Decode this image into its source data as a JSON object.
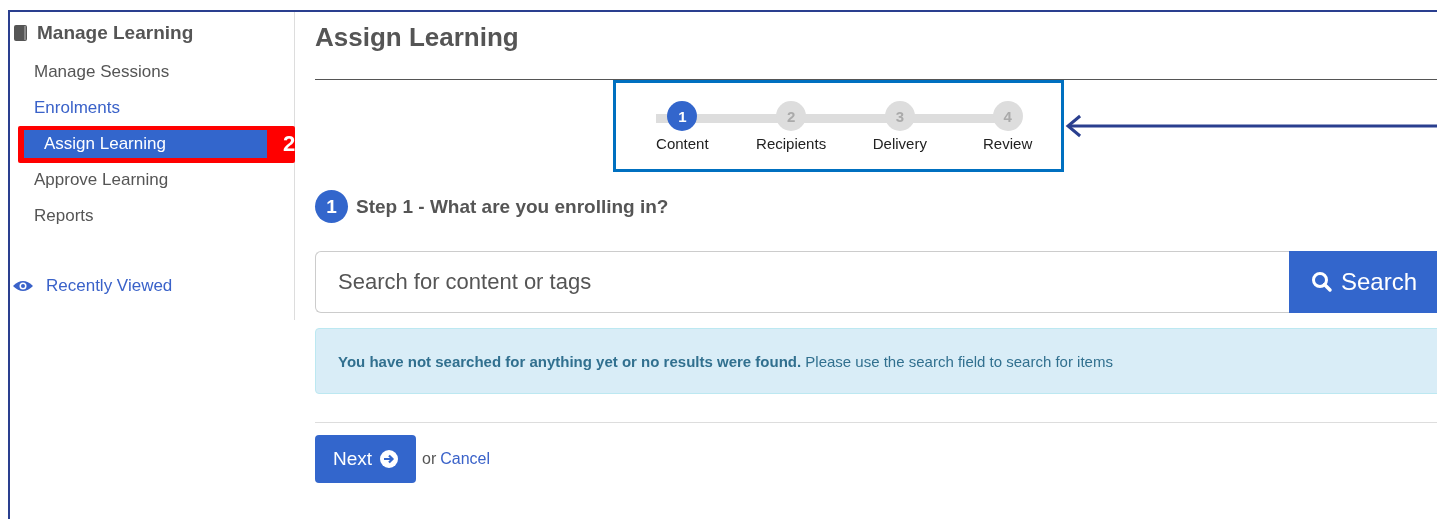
{
  "sidebar": {
    "title": "Manage Learning",
    "items": [
      {
        "label": "Manage Sessions",
        "kind": "text",
        "selected": false
      },
      {
        "label": "Enrolments",
        "kind": "link",
        "selected": false
      },
      {
        "label": "Assign Learning",
        "kind": "text",
        "selected": true
      },
      {
        "label": "Approve Learning",
        "kind": "text",
        "selected": false
      },
      {
        "label": "Reports",
        "kind": "text",
        "selected": false
      }
    ],
    "recent": "Recently Viewed"
  },
  "annotation": {
    "label": "2"
  },
  "page_title": "Assign Learning",
  "stepper": {
    "steps": [
      {
        "number": "1",
        "label": "Content",
        "selected": true
      },
      {
        "number": "2",
        "label": "Recipients",
        "selected": false
      },
      {
        "number": "3",
        "label": "Delivery",
        "selected": false
      },
      {
        "number": "4",
        "label": "Review",
        "selected": false
      }
    ]
  },
  "step_heading": {
    "number": "1",
    "text": "Step 1 - What are you enrolling in?"
  },
  "search": {
    "placeholder": "Search for content or tags",
    "button": "Search"
  },
  "alert": "**You have not searched for anything yet or no results were found.** Please use the search field to search for items",
  "actions": {
    "next": "Next",
    "or": "or",
    "cancel": "Cancel"
  }
}
